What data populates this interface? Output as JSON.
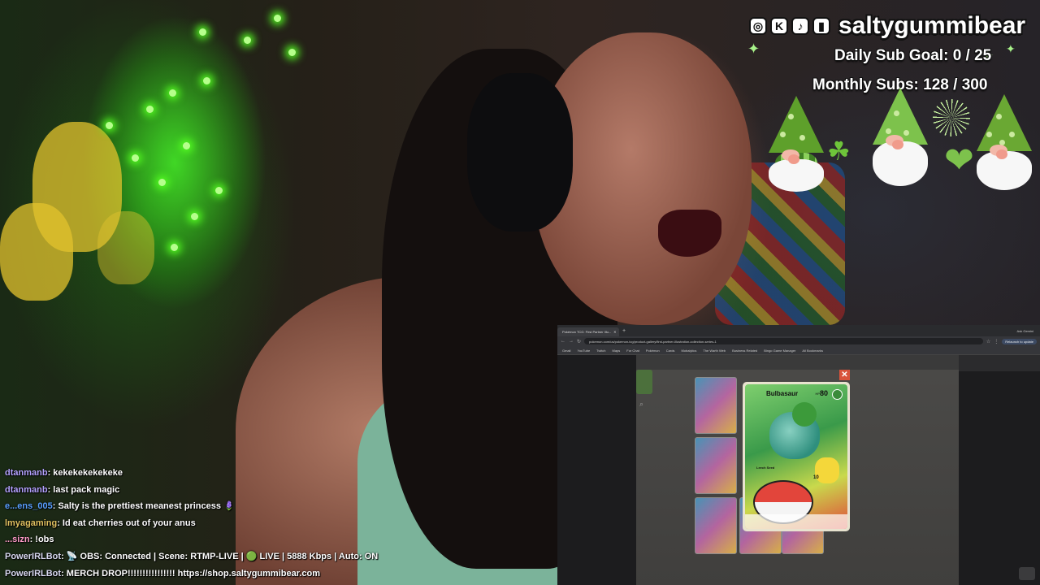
{
  "overlay": {
    "channel_name": "saltygummibear",
    "social_icons": [
      "instagram-icon",
      "kick-icon",
      "tiktok-icon",
      "twitch-icon"
    ],
    "daily_sub_goal": "Daily Sub Goal:  0 / 25",
    "monthly_subs": "Monthly Subs: 128 / 300"
  },
  "chat": {
    "messages": [
      {
        "user": "dtanmanb",
        "sep": ": ",
        "text": "kekekekekekeke",
        "color": "#b4a2ff"
      },
      {
        "user": "dtanmanb",
        "sep": ": ",
        "text": "last pack magic",
        "color": "#b4a2ff"
      },
      {
        "user": "e...ens_005",
        "sep": ": ",
        "text": "Salty is the prettiest meanest princess 🪻",
        "color": "#5aa0ff"
      },
      {
        "user": "lmyagaming",
        "sep": ": ",
        "text": "Id eat cherries out of your anus",
        "color": "#e0c060"
      },
      {
        "user": "...sizn",
        "sep": ": ",
        "text": "!obs",
        "color": "#ff9cc8"
      },
      {
        "user": "PowerIRLBot",
        "sep": ": ",
        "text": "📡 OBS: Connected | Scene: RTMP-LIVE | 🟢 LIVE | 5888 Kbps | Auto: ON",
        "color": "#d8d8f0"
      },
      {
        "user": "PowerIRLBot",
        "sep": ": ",
        "text": "MERCH DROP!!!!!!!!!!!!!!!! https://shop.saltygummibear.com",
        "color": "#d8d8f0"
      }
    ]
  },
  "browser": {
    "tab_title": "Pokémon TCG: First Partner Illu...",
    "update_label": "Relaunch to update",
    "profile_label": "Ask Gemini",
    "url": "pokemon.com/us/pokemon-tcg/product-gallery/first-partner-illustration-collection-series-1",
    "bookmarks": [
      "Gmail",
      "YouTube",
      "Twitch",
      "Maps",
      "For Chat",
      "Pokémon",
      "Cards",
      "Mobalytics",
      "The Warth Web",
      "Business Related",
      "Bingo Game Manager",
      "All Bookmarks"
    ],
    "card": {
      "name": "Bulbasaur",
      "hp_label": "HP",
      "hp": "80",
      "ability_name": "Leech Seed",
      "attack_damage": "10"
    }
  }
}
